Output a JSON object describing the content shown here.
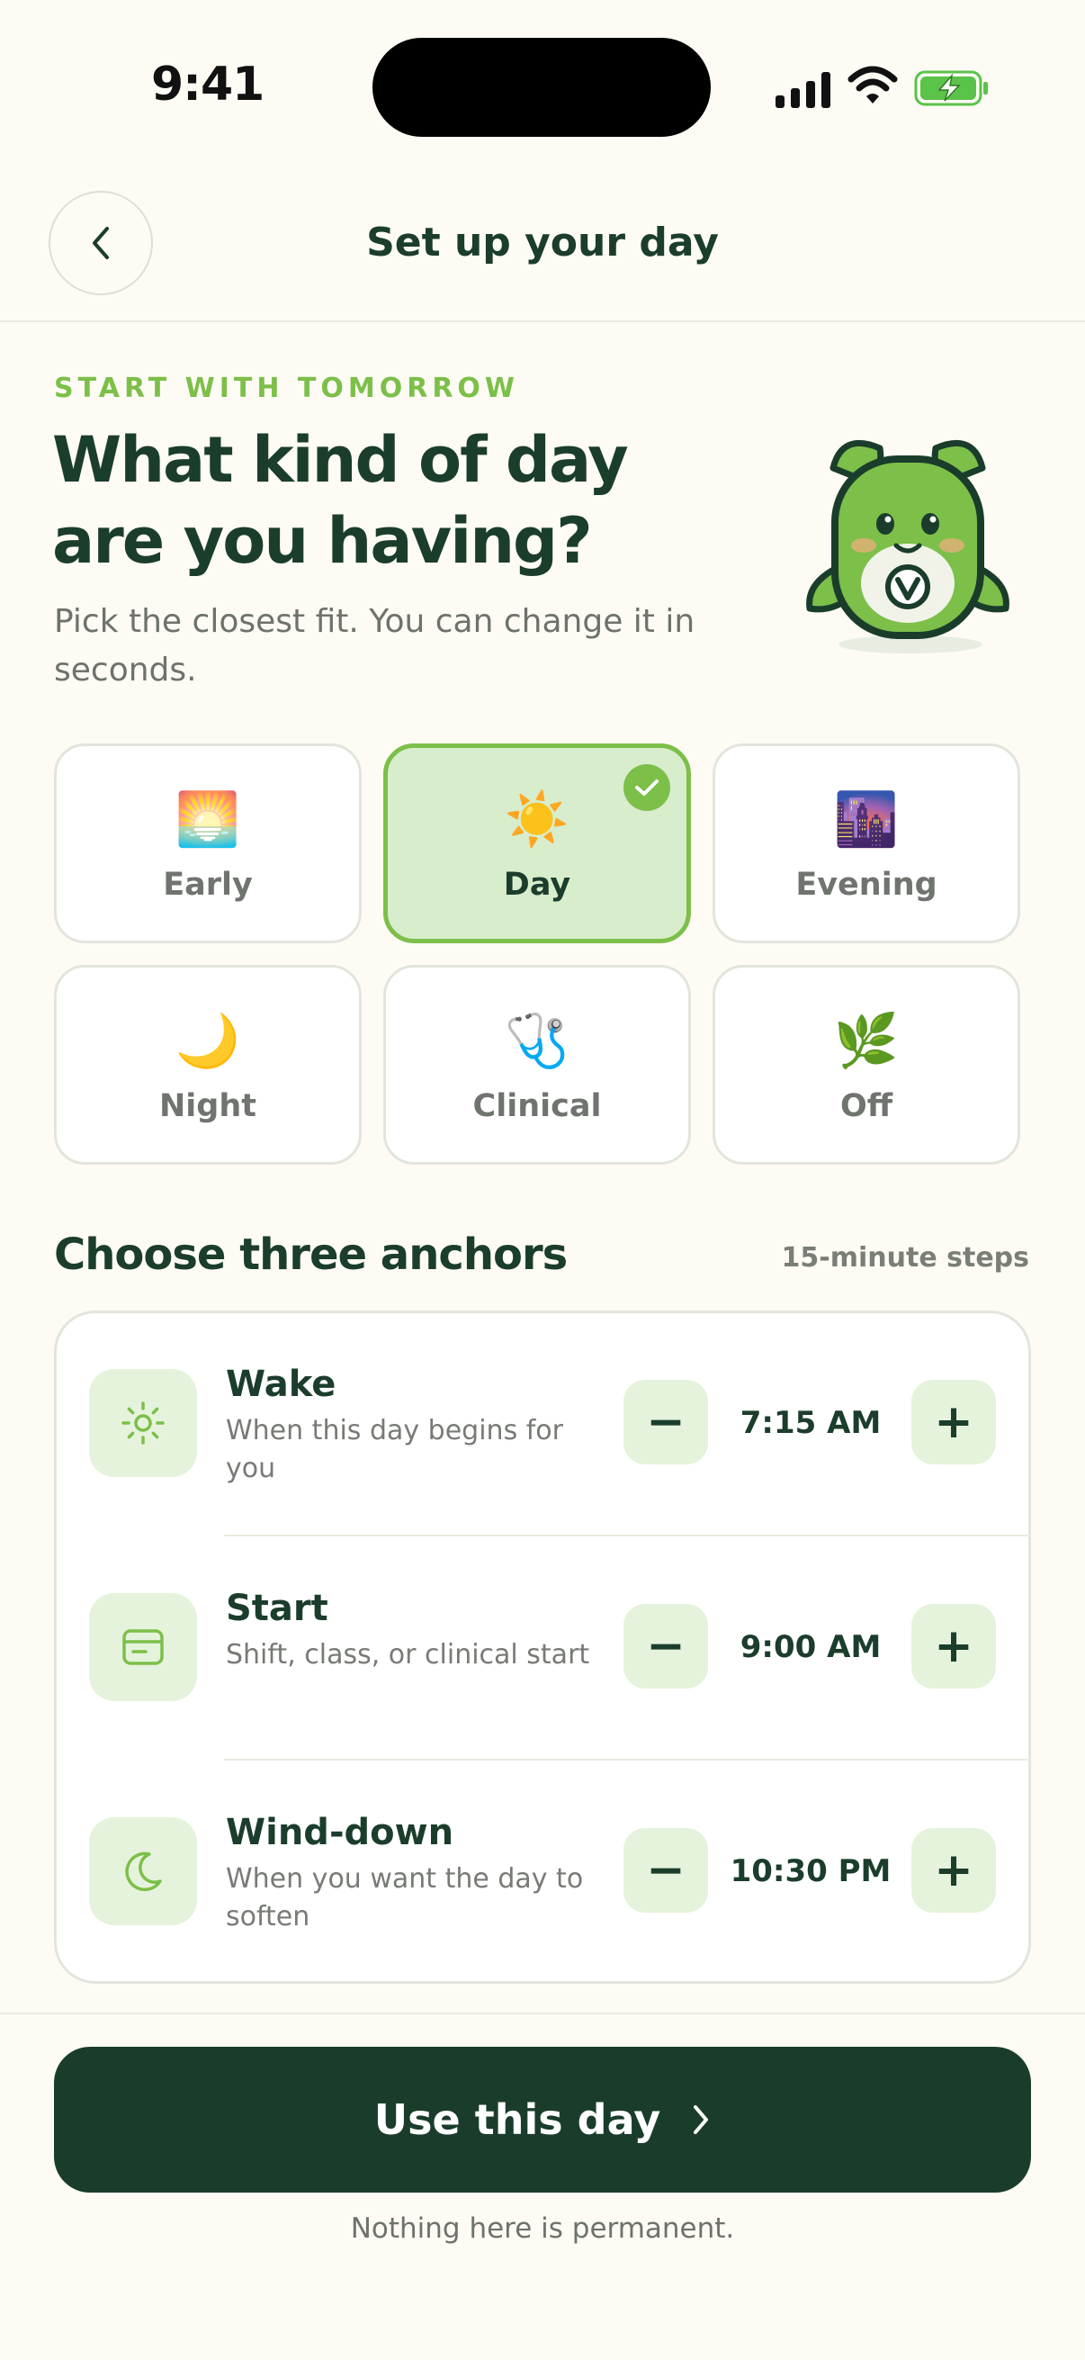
{
  "status": {
    "time": "9:41"
  },
  "nav": {
    "title": "Set up your day"
  },
  "hero": {
    "eyebrow": "START WITH TOMORROW",
    "headline": "What kind of day are you having?",
    "subtitle": "Pick the closest fit. You can change it in seconds."
  },
  "day_types": [
    {
      "label": "Early",
      "icon": "sunrise-icon",
      "selected": false
    },
    {
      "label": "Day",
      "icon": "sun-icon",
      "selected": true
    },
    {
      "label": "Evening",
      "icon": "city-dusk-icon",
      "selected": false
    },
    {
      "label": "Night",
      "icon": "crescent-moon-icon",
      "selected": false
    },
    {
      "label": "Clinical",
      "icon": "stethoscope-icon",
      "selected": false
    },
    {
      "label": "Off",
      "icon": "herb-icon",
      "selected": false
    }
  ],
  "anchors": {
    "title": "Choose three anchors",
    "note": "15-minute steps",
    "items": [
      {
        "title": "Wake",
        "description": "When this day begins for you",
        "time": "7:15 AM",
        "icon": "sun-outline-icon"
      },
      {
        "title": "Start",
        "description": "Shift, class, or clinical start",
        "time": "9:00 AM",
        "icon": "card-icon"
      },
      {
        "title": "Wind-down",
        "description": "When you want the day to soften",
        "time": "10:30 PM",
        "icon": "moon-outline-icon"
      }
    ],
    "decrement_label": "−",
    "increment_label": "+"
  },
  "footer": {
    "cta_label": "Use this day",
    "note": "Nothing here is permanent."
  },
  "colors": {
    "accent": "#7CBF49",
    "primary_dark": "#1A3D2B",
    "background": "#FDFBF4",
    "selected_tile": "#D8EDCC"
  }
}
